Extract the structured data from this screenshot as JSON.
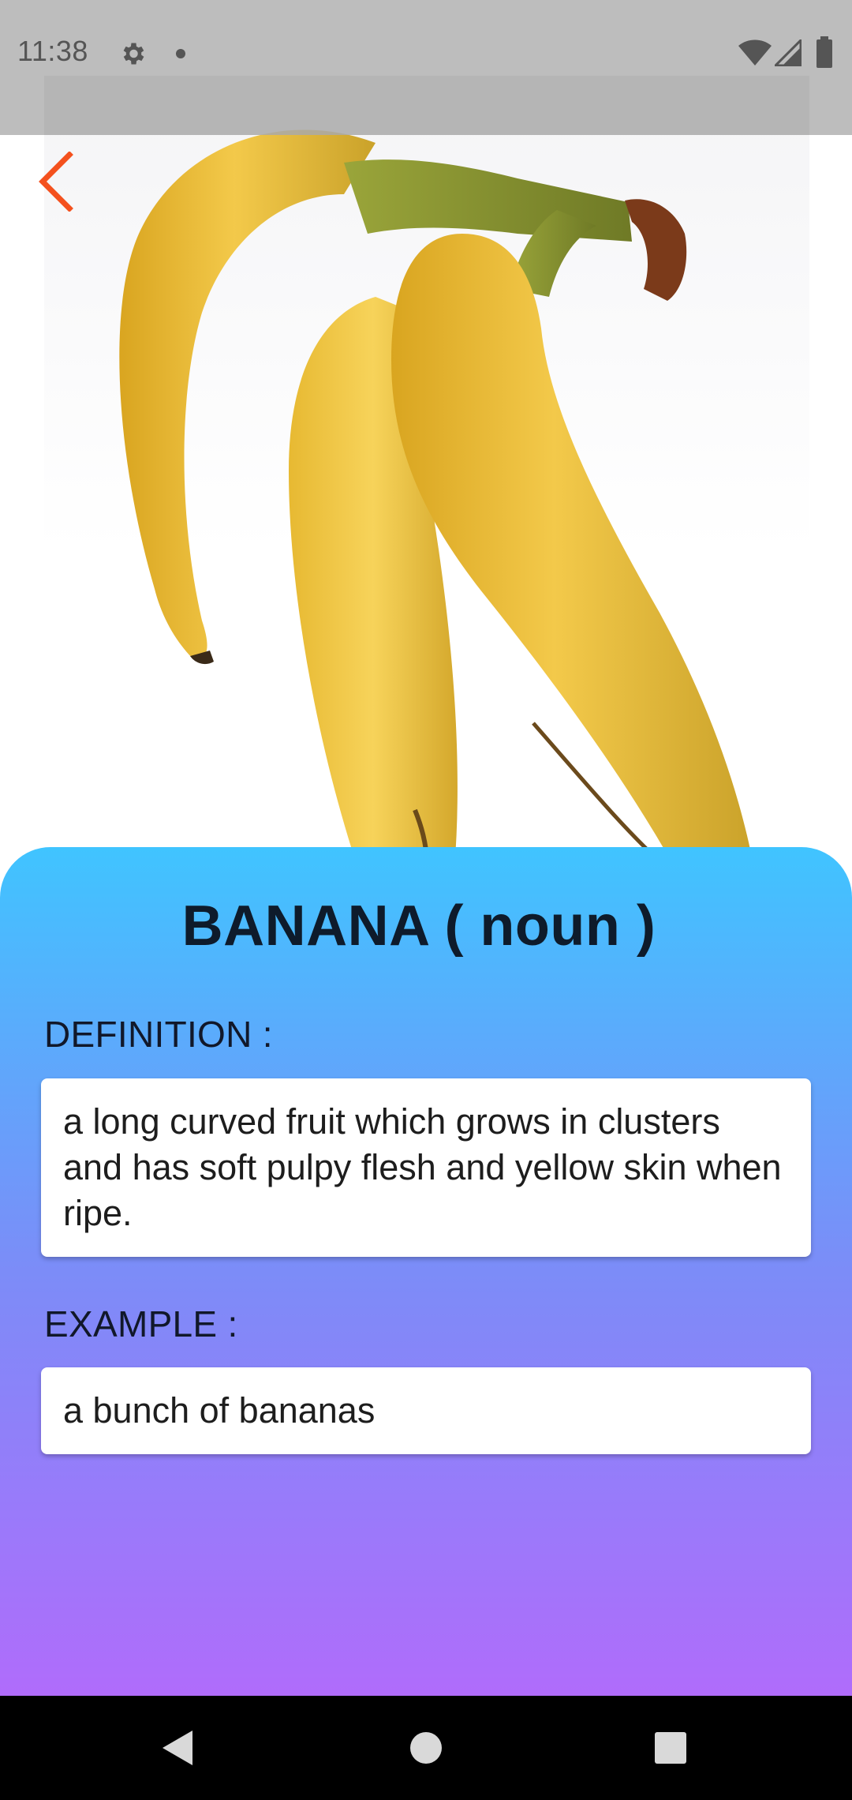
{
  "status_bar": {
    "time": "11:38",
    "icons": [
      "gear-icon",
      "dot-icon",
      "wifi-icon",
      "signal-icon",
      "battery-icon"
    ]
  },
  "header": {
    "back_icon": "chevron-left-icon",
    "image_subject": "banana-photo"
  },
  "word": {
    "title": "BANANA ( noun )",
    "definition_label": "DEFINITION :",
    "definition": "a long curved fruit which grows in clusters and has soft pulpy flesh and yellow skin when ripe.",
    "example_label": "EXAMPLE :",
    "example": "a bunch of bananas"
  },
  "nav_bar": {
    "icons": [
      "nav-back-icon",
      "nav-home-icon",
      "nav-recents-icon"
    ]
  },
  "colors": {
    "accent": "#f4511e",
    "card_gradient_top": "#40c4ff",
    "card_gradient_bottom": "#b06cfb",
    "title_text": "#0e1b2b"
  }
}
